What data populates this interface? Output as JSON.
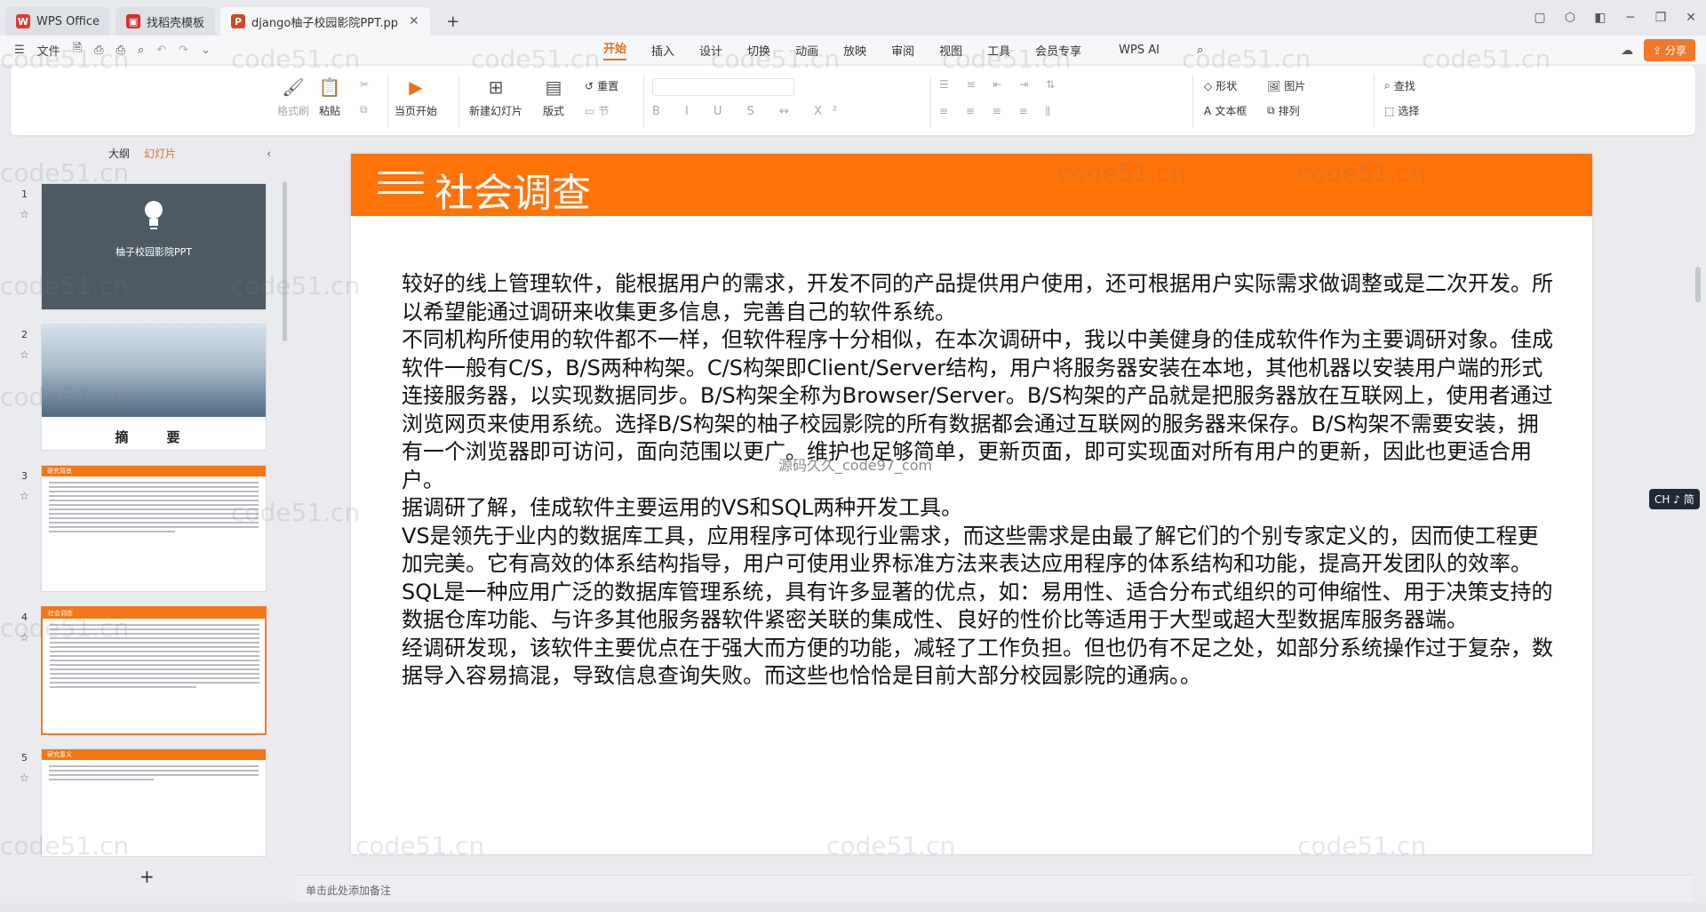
{
  "titlebar": {
    "tabs": [
      {
        "label": "WPS Office",
        "icon": "wps-logo-icon",
        "color": "#e23b2e"
      },
      {
        "label": "找稻壳模板",
        "icon": "docer-icon",
        "color": "#d4312c"
      },
      {
        "label": "django柚子校园影院PPT.pp",
        "icon": "ppt-file-icon",
        "color": "#d24726"
      }
    ],
    "new_tab": "+"
  },
  "menu": {
    "file": "文件",
    "tabs": [
      "开始",
      "插入",
      "设计",
      "切换",
      "动画",
      "放映",
      "审阅",
      "视图",
      "工具",
      "会员专享"
    ],
    "active_tab": "开始",
    "wps_ai": "WPS AI",
    "share": "分享"
  },
  "ribbon": {
    "format_painter": "格式刷",
    "paste": "粘贴",
    "play_from_current": "当页开始",
    "new_slide": "新建幻灯片",
    "layout": "版式",
    "reset": "重置",
    "section": "节",
    "shape": "形状",
    "picture": "图片",
    "textbox": "文本框",
    "arrange": "排列",
    "find": "查找",
    "select": "选择"
  },
  "leftpanel": {
    "tab_outline": "大纲",
    "tab_slides": "幻灯片",
    "selected_index": 4,
    "slides": [
      {
        "num": "1",
        "caption": "柚子校园影院PPT"
      },
      {
        "num": "2",
        "caption": "摘　要"
      },
      {
        "num": "3",
        "caption": "研究背景"
      },
      {
        "num": "4",
        "caption": "社会调查"
      },
      {
        "num": "5",
        "caption": "研究意义"
      }
    ],
    "add": "+"
  },
  "slide": {
    "title": "社会调查",
    "paragraphs": [
      "较好的线上管理软件，能根据用户的需求，开发不同的产品提供用户使用，还可根据用户实际需求做调整或是二次开发。所以希望能通过调研来收集更多信息，完善自己的软件系统。",
      "不同机构所使用的软件都不一样，但软件程序十分相似，在本次调研中，我以中美健身的佳成软件作为主要调研对象。佳成软件一般有C/S，B/S两种构架。C/S构架即Client/Server结构，用户将服务器安装在本地，其他机器以安装用户端的形式连接服务器，以实现数据同步。B/S构架全称为Browser/Server。B/S构架的产品就是把服务器放在互联网上，使用者通过浏览网页来使用系统。选择B/S构架的柚子校园影院的所有数据都会通过互联网的服务器来保存。B/S构架不需要安装，拥有一个浏览器即可访问，面向范围以更广。维护也足够简单，更新页面，即可实现面对所有用户的更新，因此也更适合用户。",
      "据调研了解，佳成软件主要运用的VS和SQL两种开发工具。",
      "VS是领先于业内的数据库工具，应用程序可体现行业需求，而这些需求是由最了解它们的个别专家定义的，因而使工程更加完美。它有高效的体系结构指导，用户可使用业界标准方法来表达应用程序的体系结构和功能，提高开发团队的效率。",
      "SQL是一种应用广泛的数据库管理系统，具有许多显著的优点，如：易用性、适合分布式组织的可伸缩性、用于决策支持的数据仓库功能、与许多其他服务器软件紧密关联的集成性、良好的性价比等适用于大型或超大型数据库服务器端。",
      "经调研发现，该软件主要优点在于强大而方便的功能，减轻了工作负担。但也仍有不足之处，如部分系统操作过于复杂，数据导入容易搞混，导致信息查询失败。而这些也恰恰是目前大部分校园影院的通病。。"
    ],
    "overlay_watermark": "源码久久_code97_com"
  },
  "notes_placeholder": "单击此处添加备注",
  "ime_indicator": "CH ♪ 简",
  "watermark_text": "code51.cn",
  "colors": {
    "accent": "#f2782a",
    "slide_header": "#ff7309",
    "thumb1_bg": "#4d5a63"
  }
}
